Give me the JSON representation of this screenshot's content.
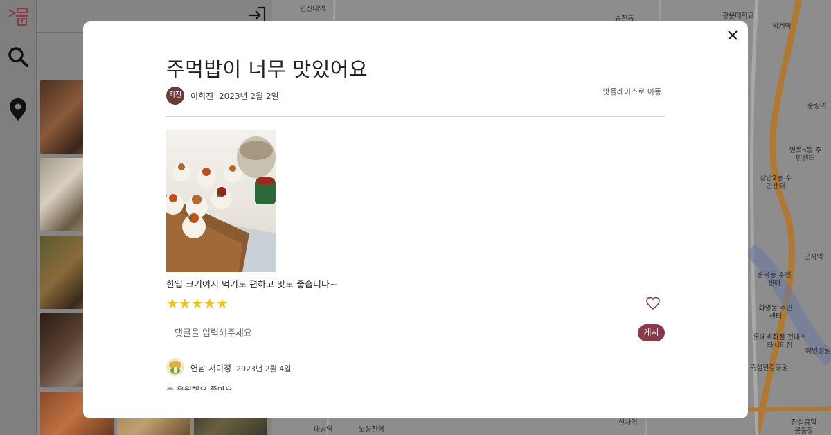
{
  "modal": {
    "title": "주먹밥이 너무 맛있어요",
    "author": {
      "avatar_text": "희진",
      "name": "이희진",
      "date": "2023년 2월 2일"
    },
    "goto_link": "맛플레이스로 이동",
    "review_text": "한입 크기여서 먹기도 편하고 맛도 좋습니다~",
    "rating": 5,
    "stars": "★★★★★",
    "comment_placeholder": "댓글을 입력해주세요",
    "post_button": "게시",
    "comments": [
      {
        "author": "연남 서미정",
        "date": "2023년 2월 4일",
        "text": "늘 응원해요 좋아요"
      }
    ]
  },
  "map": {
    "labels": [
      "연신내역",
      "광운대학교",
      "석계역",
      "송천동",
      "중랑역",
      "면목5동 주민센터",
      "장안2동 주민센터",
      "군자역",
      "중곡동 주민센터",
      "화양동 주민센터",
      "롯데백화점 건대스타시티점",
      "혜민병원",
      "뚝섬한강공원",
      "신사역",
      "잠실종합 운동장",
      "대방역",
      "노량진역"
    ]
  },
  "colors": {
    "accent": "#8a3a4a",
    "star": "#f2c21b",
    "avatar": "#6b3a3a"
  }
}
